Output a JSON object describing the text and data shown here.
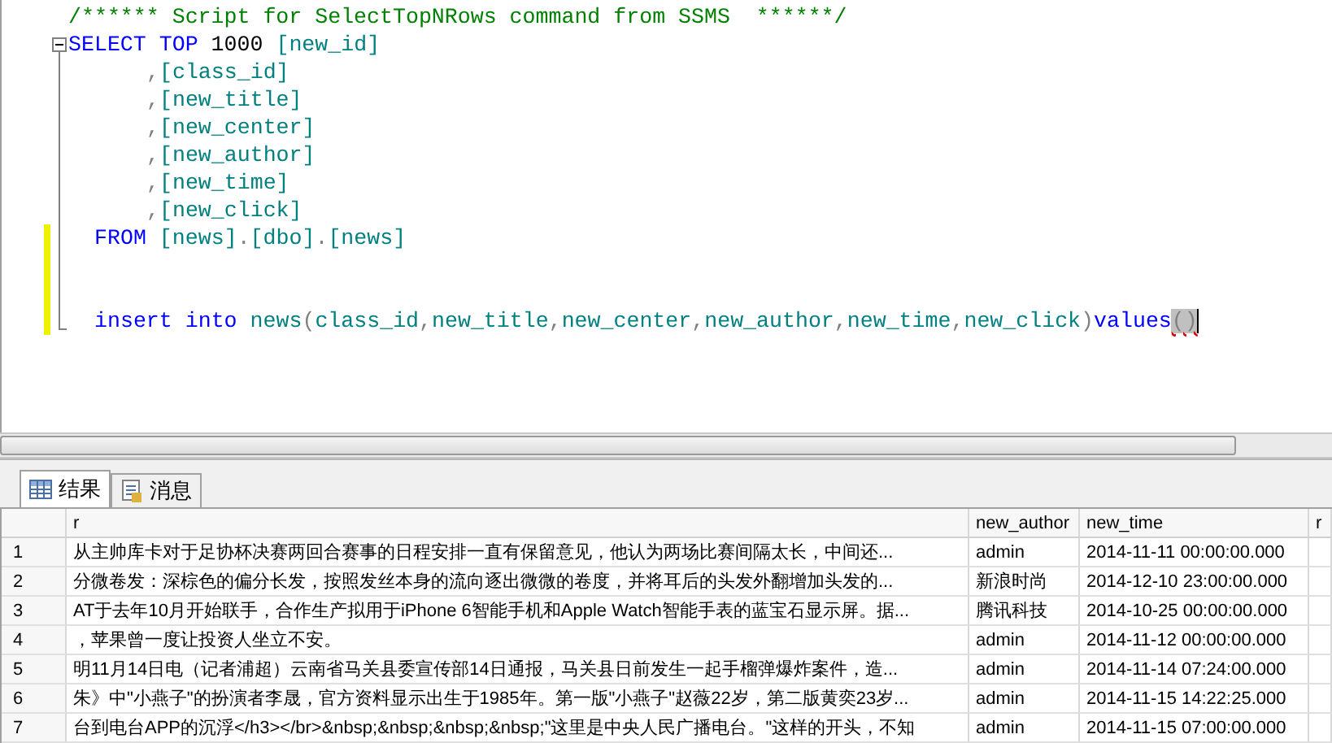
{
  "editor": {
    "blocks": [
      {
        "lines": [
          {
            "kind": "comment",
            "changed": false,
            "tokens": [
              {
                "kind": "comment",
                "text": "/****** Script for SelectTopNRows command from SSMS  ******/"
              }
            ]
          }
        ]
      },
      {
        "expanded": true,
        "lines": [
          {
            "kind": "statement",
            "changed": false,
            "tokens": [
              {
                "kind": "keyword",
                "text": "SELECT TOP"
              },
              {
                "kind": "plain",
                "text": "1000"
              },
              {
                "kind": "ident",
                "text": "[new_id]"
              }
            ]
          },
          {
            "kind": "column",
            "changed": false,
            "tokens": [
              {
                "kind": "punct",
                "text": ","
              },
              {
                "kind": "ident",
                "text": "[class_id]"
              }
            ]
          },
          {
            "kind": "column",
            "changed": false,
            "tokens": [
              {
                "kind": "punct",
                "text": ","
              },
              {
                "kind": "ident",
                "text": "[new_title]"
              }
            ]
          },
          {
            "kind": "column",
            "changed": false,
            "tokens": [
              {
                "kind": "punct",
                "text": ","
              },
              {
                "kind": "ident",
                "text": "[new_center]"
              }
            ]
          },
          {
            "kind": "column",
            "changed": false,
            "tokens": [
              {
                "kind": "punct",
                "text": ","
              },
              {
                "kind": "ident",
                "text": "[new_author]"
              }
            ]
          },
          {
            "kind": "column",
            "changed": false,
            "tokens": [
              {
                "kind": "punct",
                "text": ","
              },
              {
                "kind": "ident",
                "text": "[new_time]"
              }
            ]
          },
          {
            "kind": "column",
            "changed": false,
            "tokens": [
              {
                "kind": "punct",
                "text": ","
              },
              {
                "kind": "ident",
                "text": "[new_click]"
              }
            ]
          },
          {
            "kind": "clause",
            "changed": true,
            "tokens": [
              {
                "kind": "keyword",
                "text": "FROM"
              },
              {
                "kind": "ident",
                "text": "[news]"
              },
              {
                "kind": "punct",
                "text": "."
              },
              {
                "kind": "ident",
                "text": "[dbo]"
              },
              {
                "kind": "punct",
                "text": "."
              },
              {
                "kind": "ident",
                "text": "[news]"
              }
            ]
          },
          {
            "kind": "blank",
            "changed": true
          },
          {
            "kind": "blank",
            "changed": true
          },
          {
            "kind": "clause",
            "changed": true,
            "cursor": true,
            "tokens": [
              {
                "kind": "keyword",
                "text": "insert into"
              },
              {
                "kind": "ident",
                "text": "news"
              },
              {
                "kind": "punct",
                "text": "("
              },
              {
                "kind": "ident",
                "text": "class_id"
              },
              {
                "kind": "punct",
                "text": ","
              },
              {
                "kind": "ident",
                "text": "new_title"
              },
              {
                "kind": "punct",
                "text": ","
              },
              {
                "kind": "ident",
                "text": "new_center"
              },
              {
                "kind": "punct",
                "text": ","
              },
              {
                "kind": "ident",
                "text": "new_author"
              },
              {
                "kind": "punct",
                "text": ","
              },
              {
                "kind": "ident",
                "text": "new_time"
              },
              {
                "kind": "punct",
                "text": ","
              },
              {
                "kind": "ident",
                "text": "new_click"
              },
              {
                "kind": "punct",
                "text": ")"
              },
              {
                "kind": "keyword",
                "text": "values"
              },
              {
                "kind": "error",
                "text": "()"
              }
            ]
          }
        ]
      }
    ]
  },
  "result_tabs": [
    {
      "label": "结果",
      "kind": "grid",
      "selected": true
    },
    {
      "label": "消息",
      "kind": "messages",
      "selected": false
    }
  ],
  "results": {
    "columns": [
      "r",
      "new_author",
      "new_time",
      "r"
    ],
    "rows": [
      {
        "number": "1",
        "r": "从主帅库卡对于足协杯决赛两回合赛事的日程安排一直有保留意见，他认为两场比赛间隔太长，中间还...",
        "new_author": "admin",
        "new_time": "2014-11-11 00:00:00.000"
      },
      {
        "number": "2",
        "r": "分微卷发：深棕色的偏分长发，按照发丝本身的流向逐出微微的卷度，并将耳后的头发外翻增加头发的...",
        "new_author": "新浪时尚",
        "new_time": "2014-12-10 23:00:00.000"
      },
      {
        "number": "3",
        "r": "AT于去年10月开始联手，合作生产拟用于iPhone 6智能手机和Apple Watch智能手表的蓝宝石显示屏。据...",
        "new_author": "腾讯科技",
        "new_time": "2014-10-25 00:00:00.000"
      },
      {
        "number": "4",
        "r": "，苹果曾一度让投资人坐立不安。",
        "new_author": "admin",
        "new_time": "2014-11-12 00:00:00.000"
      },
      {
        "number": "5",
        "r": "明11月14日电（记者浦超）云南省马关县委宣传部14日通报，马关县日前发生一起手榴弹爆炸案件，造...",
        "new_author": "admin",
        "new_time": "2014-11-14 07:24:00.000"
      },
      {
        "number": "6",
        "r": "朱》中\"小燕子\"的扮演者李晟，官方资料显示出生于1985年。第一版\"小燕子\"赵薇22岁，第二版黄奕23岁...",
        "new_author": "admin",
        "new_time": "2014-11-15 14:22:25.000"
      },
      {
        "number": "7",
        "r": "台到电台APP的沉浮</h3></br>&nbsp;&nbsp;&nbsp;&nbsp;\"这里是中央人民广播电台。\"这样的开头，不知",
        "new_author": "admin",
        "new_time": "2014-11-15 07:00:00.000"
      }
    ]
  }
}
